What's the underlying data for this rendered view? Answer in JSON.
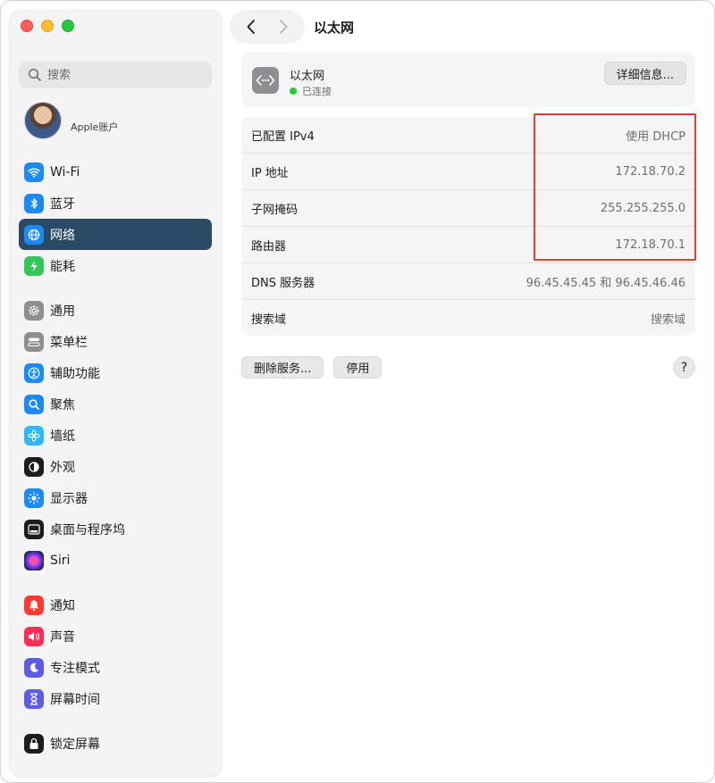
{
  "sidebar": {
    "search_placeholder": "搜索",
    "account_label": "Apple账户",
    "group1": [
      {
        "label": "Wi-Fi",
        "icon": "wifi-icon",
        "color": "#1b8af7"
      },
      {
        "label": "蓝牙",
        "icon": "bluetooth-icon",
        "color": "#1b8af7"
      },
      {
        "label": "网络",
        "icon": "network-globe-icon",
        "color": "#1b8af7",
        "active": true
      },
      {
        "label": "能耗",
        "icon": "battery-bolt-icon",
        "color": "#33c759"
      }
    ],
    "group2": [
      {
        "label": "通用",
        "icon": "gear-icon",
        "color": "#8e8e93"
      },
      {
        "label": "菜单栏",
        "icon": "menubar-icon",
        "color": "#8e8e93"
      },
      {
        "label": "辅助功能",
        "icon": "accessibility-icon",
        "color": "#1b8af7"
      },
      {
        "label": "聚焦",
        "icon": "spotlight-icon",
        "color": "#1b8af7"
      },
      {
        "label": "墙纸",
        "icon": "wallpaper-flower-icon",
        "color": "#2fb7f5"
      },
      {
        "label": "外观",
        "icon": "appearance-icon",
        "color": "#1d1d1f"
      },
      {
        "label": "显示器",
        "icon": "display-brightness-icon",
        "color": "#1b8af7"
      },
      {
        "label": "桌面与程序坞",
        "icon": "dock-icon",
        "color": "#1d1d1f"
      },
      {
        "label": "Siri",
        "icon": "siri-icon",
        "color": "#5a2ea6"
      }
    ],
    "group3": [
      {
        "label": "通知",
        "icon": "bell-icon",
        "color": "#ff3b30"
      },
      {
        "label": "声音",
        "icon": "speaker-icon",
        "color": "#ff2d55"
      },
      {
        "label": "专注模式",
        "icon": "moon-icon",
        "color": "#5e5ce6"
      },
      {
        "label": "屏幕时间",
        "icon": "hourglass-icon",
        "color": "#5e5ce6"
      }
    ],
    "group4": [
      {
        "label": "锁定屏幕",
        "icon": "lock-icon",
        "color": "#1d1d1f"
      }
    ]
  },
  "toolbar": {
    "title": "以太网"
  },
  "connection": {
    "name": "以太网",
    "status": "已连接",
    "details_label": "详细信息..."
  },
  "info_rows": [
    {
      "key": "已配置 IPv4",
      "value": "使用 DHCP"
    },
    {
      "key": "IP 地址",
      "value": "172.18.70.2"
    },
    {
      "key": "子网掩码",
      "value": "255.255.255.0"
    },
    {
      "key": "路由器",
      "value": "172.18.70.1"
    },
    {
      "key": "DNS 服务器",
      "value": "96.45.45.45 和 96.45.46.46"
    },
    {
      "key": "搜索域",
      "value": "搜索域"
    }
  ],
  "actions": {
    "remove_service": "删除服务...",
    "disable": "停用",
    "help": "?"
  },
  "colors": {
    "sidebar_active": "#2b4a66",
    "highlight_border": "#e53e2f",
    "status_connected": "#28c840"
  }
}
